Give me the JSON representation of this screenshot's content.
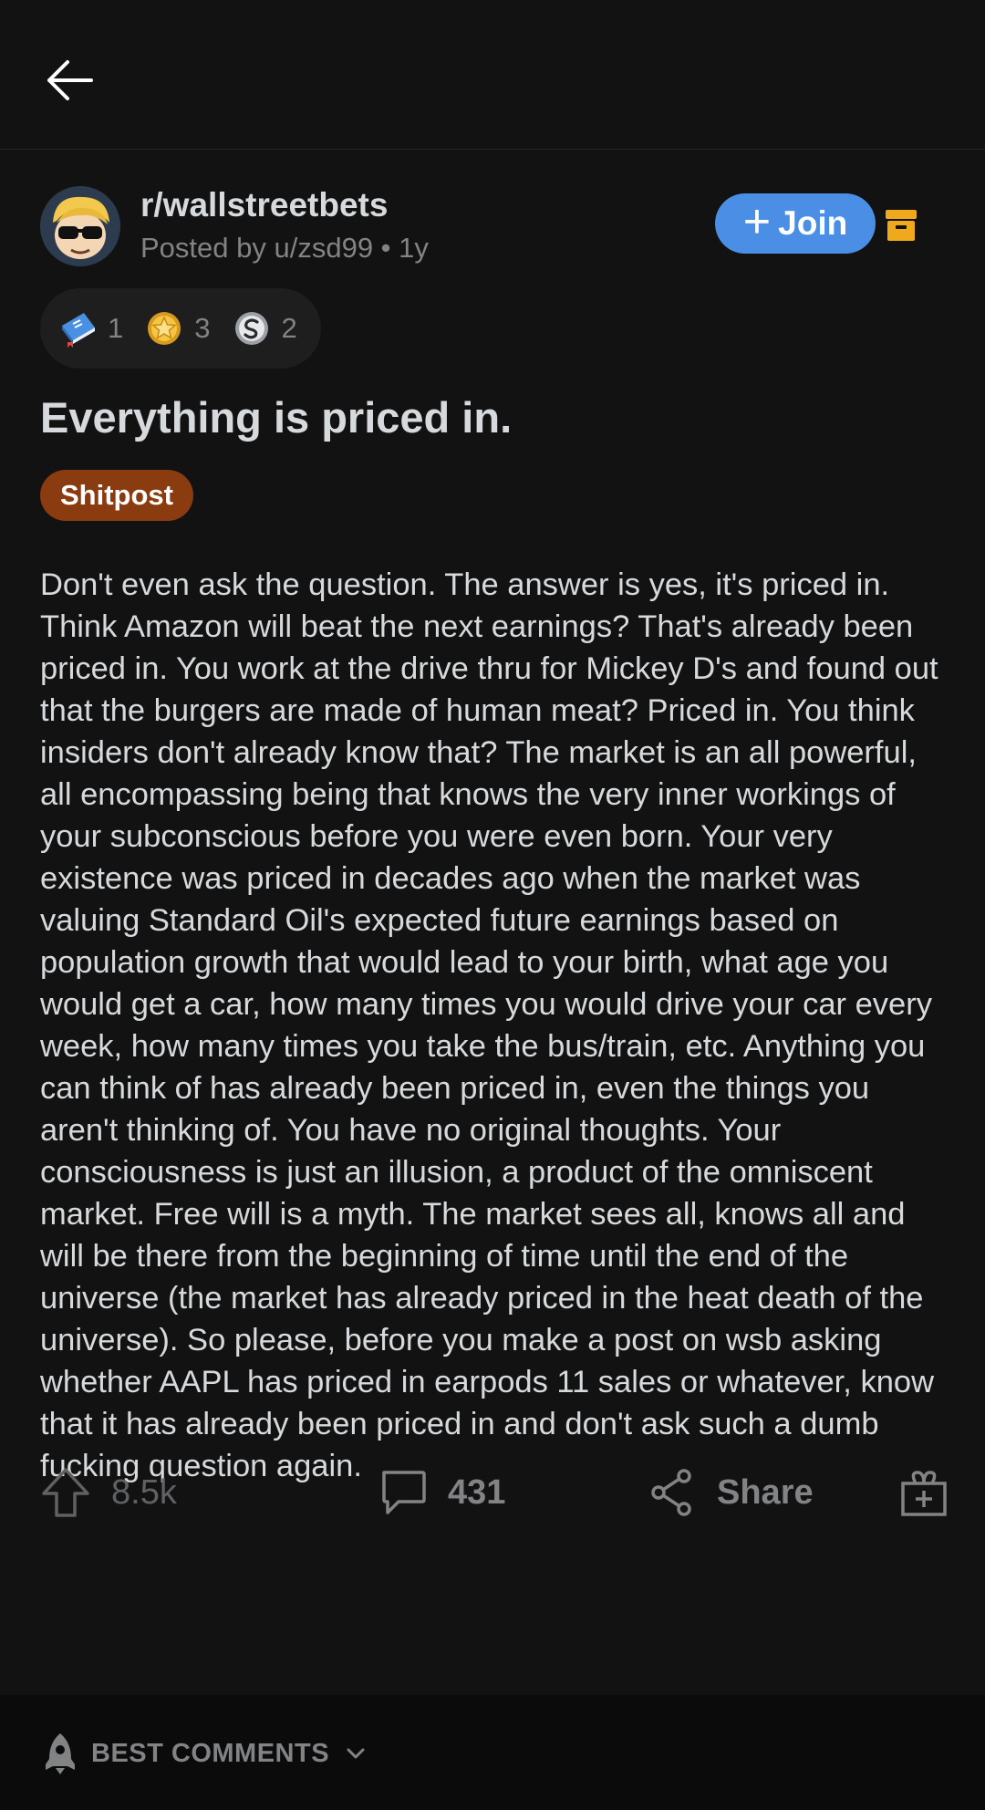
{
  "post": {
    "subreddit": "r/wallstreetbets",
    "posted_by": "Posted by u/zsd99 • 1y",
    "join_label": "Join",
    "join_plus": "+",
    "awards": [
      {
        "icon": "book-award-icon",
        "count": "1"
      },
      {
        "icon": "gold-star-award-icon",
        "count": "3"
      },
      {
        "icon": "silver-award-icon",
        "count": "2"
      }
    ],
    "title": "Everything is priced in.",
    "flair": "Shitpost",
    "body": "Don't even ask the question. The answer is yes, it's priced in. Think Amazon will beat the next earnings? That's already been priced in. You work at the drive thru for Mickey D's and found out that the burgers are made of human meat? Priced in. You think insiders don't already know that? The market is an all powerful, all encompassing being that knows the very inner workings of your subconscious before you were even born. Your very existence was priced in decades ago when the market was valuing Standard Oil's expected future earnings based on population growth that would lead to your birth, what age you would get a car, how many times you would drive your car every week, how many times you take the bus/train, etc. Anything you can think of has already been priced in, even the things you aren't thinking of. You have no original thoughts. Your consciousness is just an illusion, a product of the omniscent market. Free will is a myth. The market sees all, knows all and will be there from the beginning of time until the end of the universe (the market has already priced in the heat death of the universe). So please, before you make a post on wsb asking whether AAPL has priced in earpods 11 sales or whatever, know that it has already been priced in and don't ask such a dumb fucking question again."
  },
  "actions": {
    "upvotes": "8.5k",
    "comments": "431",
    "share": "Share"
  },
  "comments_bar": {
    "sort_label": "BEST COMMENTS"
  },
  "colors": {
    "background": "#121212",
    "join": "#4a8ee6",
    "flair": "#8a3b0f",
    "archive": "#f0a81c"
  }
}
